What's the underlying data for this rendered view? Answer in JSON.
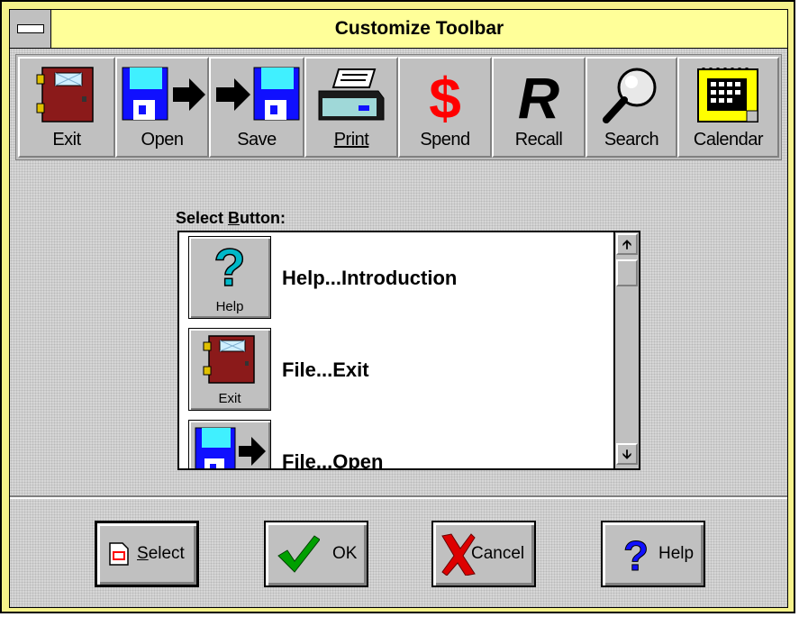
{
  "window": {
    "title": "Customize Toolbar"
  },
  "toolbar": {
    "buttons": [
      {
        "label": "Exit",
        "icon": "door-icon"
      },
      {
        "label": "Open",
        "icon": "disk-arrow-icon"
      },
      {
        "label": "Save",
        "icon": "arrow-disk-icon"
      },
      {
        "label": "Print",
        "icon": "printer-icon"
      },
      {
        "label": "Spend",
        "icon": "dollar-icon"
      },
      {
        "label": "Recall",
        "icon": "recall-r-icon"
      },
      {
        "label": "Search",
        "icon": "magnifier-icon"
      },
      {
        "label": "Calendar",
        "icon": "calendar-icon"
      }
    ]
  },
  "select": {
    "label_pre": "Select ",
    "label_accel": "B",
    "label_post": "utton:",
    "items": [
      {
        "button_label": "Help",
        "text": "Help...Introduction",
        "icon": "question-icon"
      },
      {
        "button_label": "Exit",
        "text": "File...Exit",
        "icon": "door-icon"
      },
      {
        "button_label": "",
        "text": "File...Open",
        "icon": "disk-arrow-icon"
      }
    ]
  },
  "buttons": {
    "select_accel": "S",
    "select_rest": "elect",
    "ok": "OK",
    "cancel": "Cancel",
    "help": "Help"
  },
  "colors": {
    "frame": "#f6f28a",
    "title_bg": "#ffff99",
    "face": "#c0c0c0",
    "door": "#8b1a1a",
    "disk": "#1010ff",
    "dollar": "#ff0000",
    "check": "#00a000",
    "question": "#00b8c8"
  }
}
